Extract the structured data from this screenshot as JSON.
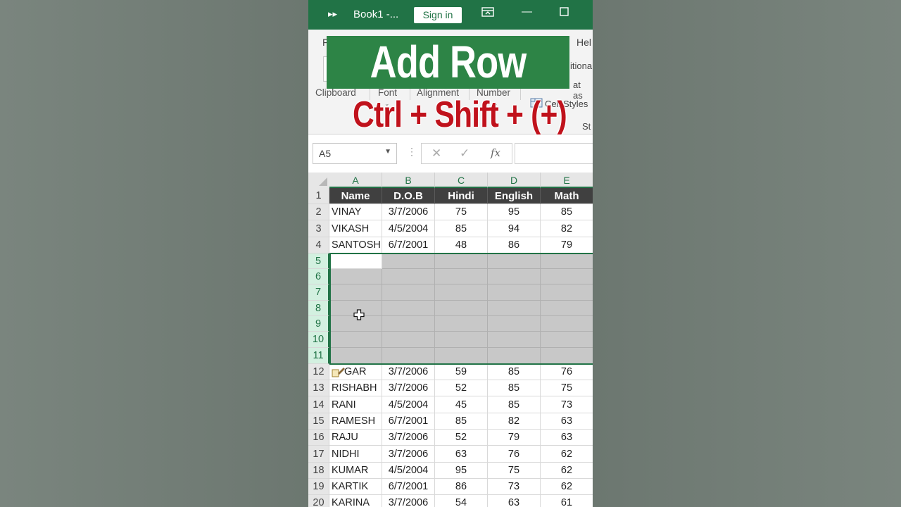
{
  "title_bar": {
    "title": "Book1  -...",
    "sign_in": "Sign in",
    "colors": {
      "bar": "#217346"
    }
  },
  "ribbon": {
    "tab_left": "F",
    "tab_right": "Hel",
    "groups": [
      "Clipboard",
      "Font",
      "Alignment",
      "Number"
    ],
    "conditional": "itional",
    "format_as": "at as",
    "cell_styles": "Cell Styles",
    "styles_short": "St"
  },
  "overlay": {
    "headline": "Add Row",
    "shortcut": "Ctrl + Shift + (+)"
  },
  "formula_bar": {
    "name_box": "A5",
    "fx": "fx",
    "value": ""
  },
  "sheet": {
    "columns": [
      "A",
      "B",
      "C",
      "D",
      "E"
    ],
    "header_row": [
      "Name",
      "D.O.B",
      "Hindi",
      "English",
      "Math"
    ],
    "rows": [
      {
        "num": "1"
      },
      {
        "num": "2",
        "cells": [
          "VINAY",
          "3/7/2006",
          "75",
          "95",
          "85"
        ]
      },
      {
        "num": "3",
        "cells": [
          "VIKASH",
          "4/5/2004",
          "85",
          "94",
          "82"
        ]
      },
      {
        "num": "4",
        "cells": [
          "SANTOSH",
          "6/7/2001",
          "48",
          "86",
          "79"
        ]
      },
      {
        "num": "5"
      },
      {
        "num": "6"
      },
      {
        "num": "7"
      },
      {
        "num": "8"
      },
      {
        "num": "9"
      },
      {
        "num": "10"
      },
      {
        "num": "11"
      },
      {
        "num": "12",
        "cells": [
          "GAR",
          "3/7/2006",
          "59",
          "85",
          "76"
        ]
      },
      {
        "num": "13",
        "cells": [
          "RISHABH",
          "3/7/2006",
          "52",
          "85",
          "75"
        ]
      },
      {
        "num": "14",
        "cells": [
          "RANI",
          "4/5/2004",
          "45",
          "85",
          "73"
        ]
      },
      {
        "num": "15",
        "cells": [
          "RAMESH",
          "6/7/2001",
          "85",
          "82",
          "63"
        ]
      },
      {
        "num": "16",
        "cells": [
          "RAJU",
          "3/7/2006",
          "52",
          "79",
          "63"
        ]
      },
      {
        "num": "17",
        "cells": [
          "NIDHI",
          "3/7/2006",
          "63",
          "76",
          "62"
        ]
      },
      {
        "num": "18",
        "cells": [
          "KUMAR",
          "4/5/2004",
          "95",
          "75",
          "62"
        ]
      },
      {
        "num": "19",
        "cells": [
          "KARTIK",
          "6/7/2001",
          "86",
          "73",
          "62"
        ]
      },
      {
        "num": "20",
        "cells": [
          "KARINA",
          "3/7/2006",
          "54",
          "63",
          "61"
        ]
      }
    ],
    "selected_rows": [
      "5",
      "6",
      "7",
      "8",
      "9",
      "10",
      "11"
    ],
    "active_cell": "A5"
  }
}
